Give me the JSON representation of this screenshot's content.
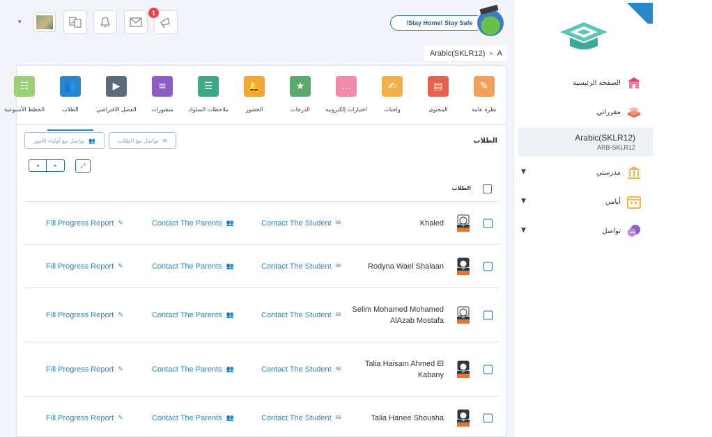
{
  "topbar": {
    "notification_count": "1",
    "stay_home": "!Stay Home! Stay Safe",
    "dropdown_caret": "▾"
  },
  "breadcrumb": {
    "current": "A",
    "separator": ">",
    "course": "Arabic(SKLR12)"
  },
  "sidebar": {
    "home": "الصفحة الرئيسية",
    "courses": "مقرراتي",
    "course_title": "Arabic(SKLR12)",
    "course_code": "ARB-SKLR12",
    "school": "مدرستي",
    "days": "أيامي",
    "communicate": "تواصل"
  },
  "tabs": [
    {
      "label": "نظرة عامة",
      "icon": "overview-icon",
      "color": "#f0a25a"
    },
    {
      "label": "المحتوى",
      "icon": "book-icon",
      "color": "#e8614f"
    },
    {
      "label": "واجبات",
      "icon": "homework-icon",
      "color": "#f0b04a"
    },
    {
      "label": "اختبارات إلكترونية",
      "icon": "quiz-icon",
      "color": "#f08ca8"
    },
    {
      "label": "الدرجات",
      "icon": "grades-icon",
      "color": "#5aaa6e"
    },
    {
      "label": "الحضور",
      "icon": "attendance-icon",
      "color": "#f0a830"
    },
    {
      "label": "ملاحظات السلوك",
      "icon": "behavior-icon",
      "color": "#3ea886"
    },
    {
      "label": "منشورات",
      "icon": "posts-icon",
      "color": "#8d5cc5"
    },
    {
      "label": "الفصل الافتراضي",
      "icon": "virtual-class-icon",
      "color": "#5c6b78"
    },
    {
      "label": "الطلاب",
      "icon": "students-icon",
      "color": "#2a86c9"
    },
    {
      "label": "الخطط الأسبوعية",
      "icon": "weekly-plan-icon",
      "color": "#9ccf7a"
    }
  ],
  "students_section": {
    "title": "الطلاب",
    "contact_students_btn": "تواصل مع الطلاب",
    "contact_parents_btn": "تواصل مع أولياء الأمور",
    "column_header": "الطلاب",
    "pager_prev": "◂",
    "pager_next": "▸",
    "expand": "⤢"
  },
  "row_actions": {
    "report": "Fill Progress Report",
    "parents": "Contact The Parents",
    "student": "Contact The Student"
  },
  "students": [
    {
      "name": "Khaled",
      "gender": "male"
    },
    {
      "name": "Rodyna Wael Shalaan",
      "gender": "female"
    },
    {
      "name": "Selim Mohamed Mohamed AlAzab Mostafa",
      "gender": "male"
    },
    {
      "name": "Talia Haisam Ahmed El Kabany",
      "gender": "female"
    },
    {
      "name": "Talia Hanee Shousha",
      "gender": "female"
    }
  ]
}
